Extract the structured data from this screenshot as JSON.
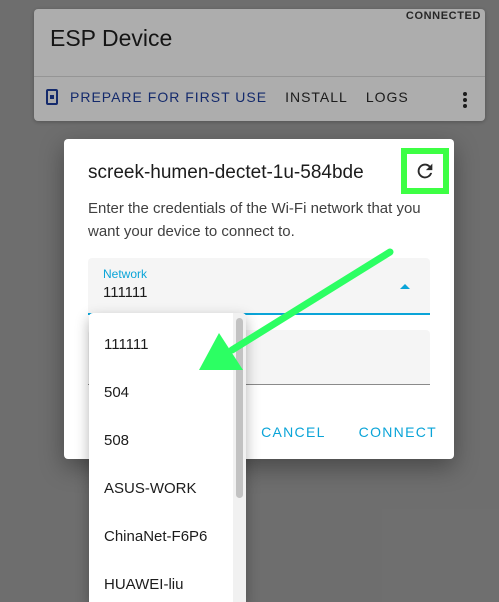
{
  "device_card": {
    "status": "CONNECTED",
    "title": "ESP Device",
    "actions": {
      "prepare": "PREPARE FOR FIRST USE",
      "install": "INSTALL",
      "logs": "LOGS"
    }
  },
  "dialog": {
    "title": "screek-humen-dectet-1u-584bde",
    "description": "Enter the credentials of the Wi-Fi network that you want your device to connect to.",
    "network_field": {
      "label": "Network",
      "value": "111111"
    },
    "buttons": {
      "cancel": "CANCEL",
      "connect": "CONNECT"
    }
  },
  "dropdown": {
    "options": [
      "111111",
      "504",
      "508",
      "ASUS-WORK",
      "ChinaNet-F6P6",
      "HUAWEI-liu"
    ]
  },
  "colors": {
    "accent": "#0aa4d8",
    "highlight": "#3dff44",
    "annotation_arrow": "#2cff63"
  }
}
